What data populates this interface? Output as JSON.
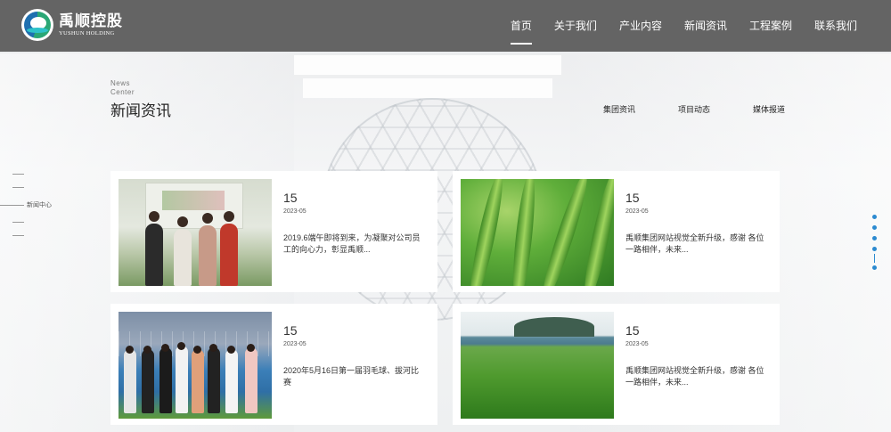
{
  "header": {
    "logo_cn": "禹顺控股",
    "logo_en": "YUSHUN HOLDING",
    "nav": [
      {
        "label": "首页",
        "active": true
      },
      {
        "label": "关于我们",
        "active": false
      },
      {
        "label": "产业内容",
        "active": false
      },
      {
        "label": "新闻资讯",
        "active": false
      },
      {
        "label": "工程案例",
        "active": false
      },
      {
        "label": "联系我们",
        "active": false
      }
    ]
  },
  "section": {
    "en_line1": "News",
    "en_line2": "Center",
    "title": "新闻资讯",
    "tabs": [
      "集团资讯",
      "项目动态",
      "媒体报道"
    ]
  },
  "side_rail": {
    "active_label": "新闻中心"
  },
  "news": [
    {
      "day": "15",
      "year_month": "2023-05",
      "desc": "2019.6端午即将到来，为凝聚对公司员工的向心力，彰显禹顺..."
    },
    {
      "day": "15",
      "year_month": "2023-05",
      "desc": "禹顺集团网站视觉全新升级，感谢 各位一路相伴，未来..."
    },
    {
      "day": "15",
      "year_month": "2023-05",
      "desc": "2020年5月16日第一届羽毛球、拔河比赛"
    },
    {
      "day": "15",
      "year_month": "2023-05",
      "desc": "禹顺集团网站视觉全新升级，感谢 各位一路相伴，未来..."
    }
  ],
  "colors": {
    "accent": "#2b8ad0",
    "header_bg": "#585858"
  }
}
